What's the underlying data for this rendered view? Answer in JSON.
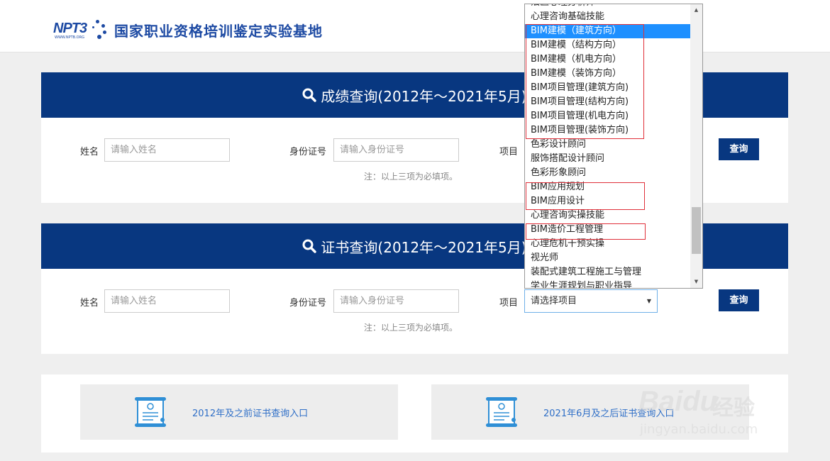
{
  "header": {
    "logo_abbr": "NPT3",
    "logo_url": "WWW.NPTB.ORG",
    "site_title": "国家职业资格培训鉴定实验基地"
  },
  "score_panel": {
    "title": "成绩查询(2012年～2021年5月)",
    "name_label": "姓名",
    "name_placeholder": "请输入姓名",
    "id_label": "身份证号",
    "id_placeholder": "请输入身份证号",
    "project_label": "项目",
    "note": "注：以上三项为必填项。",
    "query_label": "查询"
  },
  "cert_panel": {
    "title": "证书查询(2012年～2021年5月)",
    "name_label": "姓名",
    "name_placeholder": "请输入姓名",
    "id_label": "身份证号",
    "id_placeholder": "请输入身份证号",
    "project_label": "项目",
    "project_value": "请选择项目",
    "note": "注：以上三项为必填项。",
    "query_label": "查询"
  },
  "dropdown": {
    "options": [
      "法医心理分析师",
      "心理咨询基础技能",
      "BIM建模（建筑方向）",
      "BIM建模（结构方向）",
      "BIM建模（机电方向）",
      "BIM建模（装饰方向）",
      "BIM项目管理(建筑方向)",
      "BIM项目管理(结构方向)",
      "BIM项目管理(机电方向)",
      "BIM项目管理(装饰方向)",
      "色彩设计顾问",
      "服饰搭配设计顾问",
      "色彩形象顾问",
      "BIM应用规划",
      "BIM应用设计",
      "心理咨询实操技能",
      "BIM造价工程管理",
      "心理危机干预实操",
      "视光师",
      "装配式建筑工程施工与管理",
      "学业生涯规划与职业指导"
    ],
    "selected_index": 2
  },
  "entries": {
    "left_label": "2012年及之前证书查询入口",
    "right_label": "2021年6月及之后证书查询入口"
  },
  "watermark": {
    "brand": "Baidu",
    "product": "经验",
    "url": "jingyan.baidu.com"
  },
  "colors": {
    "primary": "#083780",
    "highlight": "#1e90ff",
    "annotation": "#e0303a",
    "link": "#2f6fc7"
  }
}
